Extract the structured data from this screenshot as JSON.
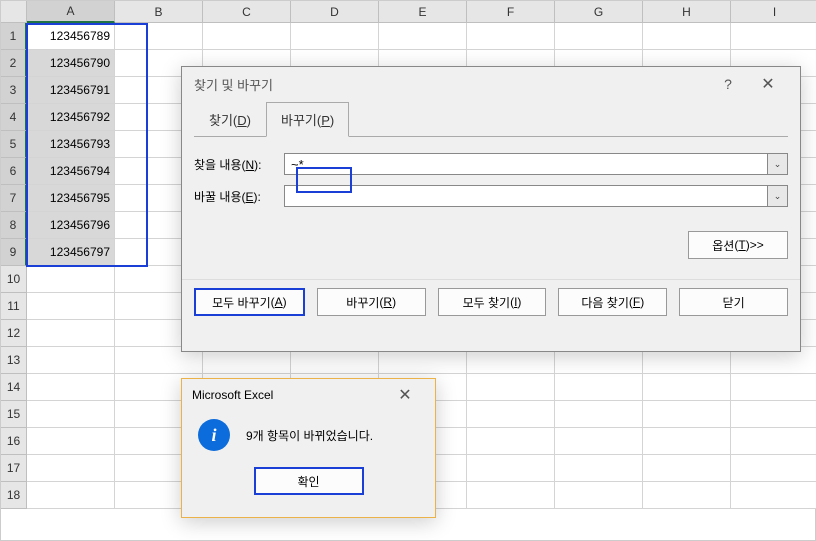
{
  "columns": [
    "A",
    "B",
    "C",
    "D",
    "E",
    "F",
    "G",
    "H",
    "I"
  ],
  "rowCount": 18,
  "selectedCol": 0,
  "selectedRows": [
    1,
    2,
    3,
    4,
    5,
    6,
    7,
    8,
    9
  ],
  "activeRow": 1,
  "cells": {
    "A1": "123456789",
    "A2": "123456790",
    "A3": "123456791",
    "A4": "123456792",
    "A5": "123456793",
    "A6": "123456794",
    "A7": "123456795",
    "A8": "123456796",
    "A9": "123456797"
  },
  "findDialog": {
    "title": "찾기 및 바꾸기",
    "help": "?",
    "tabs": {
      "find": "찾기",
      "findKey": "D",
      "replace": "바꾸기",
      "replaceKey": "P",
      "active": 1
    },
    "findLabel": "찾을 내용",
    "findKey": "N",
    "findValue": "~*",
    "replaceLabel": "바꿀 내용",
    "replaceKey": "E",
    "replaceValue": "",
    "optionsLabel": "옵션",
    "optionsKey": "T",
    "optionsSuffix": " >>",
    "btnReplaceAll": "모두 바꾸기",
    "btnReplaceAllKey": "A",
    "btnReplace": "바꾸기",
    "btnReplaceKey": "R",
    "btnFindAll": "모두 찾기",
    "btnFindAllKey": "I",
    "btnFindNext": "다음 찾기",
    "btnFindNextKey": "F",
    "btnClose": "닫기"
  },
  "msgBox": {
    "title": "Microsoft Excel",
    "icon": "i",
    "text": "9개 항목이 바뀌었습니다.",
    "ok": "확인"
  }
}
